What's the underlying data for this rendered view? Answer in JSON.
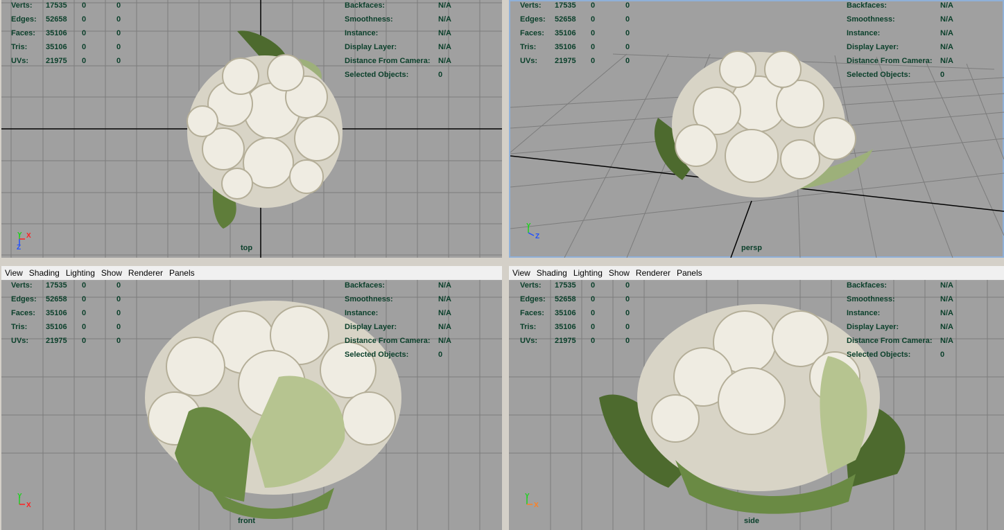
{
  "menu": [
    "View",
    "Shading",
    "Lighting",
    "Show",
    "Renderer",
    "Panels"
  ],
  "stats": [
    {
      "label": "Verts:",
      "a": "17535",
      "b": "0",
      "c": "0"
    },
    {
      "label": "Edges:",
      "a": "52658",
      "b": "0",
      "c": "0"
    },
    {
      "label": "Faces:",
      "a": "35106",
      "b": "0",
      "c": "0"
    },
    {
      "label": "Tris:",
      "a": "35106",
      "b": "0",
      "c": "0"
    },
    {
      "label": "UVs:",
      "a": "21975",
      "b": "0",
      "c": "0"
    }
  ],
  "info": [
    {
      "label": "Backfaces:",
      "value": "N/A"
    },
    {
      "label": "Smoothness:",
      "value": "N/A"
    },
    {
      "label": "Instance:",
      "value": "N/A"
    },
    {
      "label": "Display Layer:",
      "value": "N/A"
    },
    {
      "label": "Distance From Camera:",
      "value": "N/A"
    },
    {
      "label": "Selected Objects:",
      "value": "0"
    }
  ],
  "viewports": [
    {
      "id": "top",
      "label": "top",
      "axes": [
        "Y",
        "X",
        "Z"
      ]
    },
    {
      "id": "persp",
      "label": "persp",
      "axes": [
        "Y",
        "Z"
      ]
    },
    {
      "id": "front",
      "label": "front",
      "axes": [
        "Y",
        "X"
      ]
    },
    {
      "id": "side",
      "label": "side",
      "axes": [
        "Y",
        "X"
      ]
    }
  ],
  "colors": {
    "viewport_bg": "#a0a0a0",
    "grid": "#7c7c7c",
    "hud_text": "#0a3f2a",
    "axis_x": "#ff2020",
    "axis_y": "#20d020",
    "axis_z": "#2050ff"
  }
}
